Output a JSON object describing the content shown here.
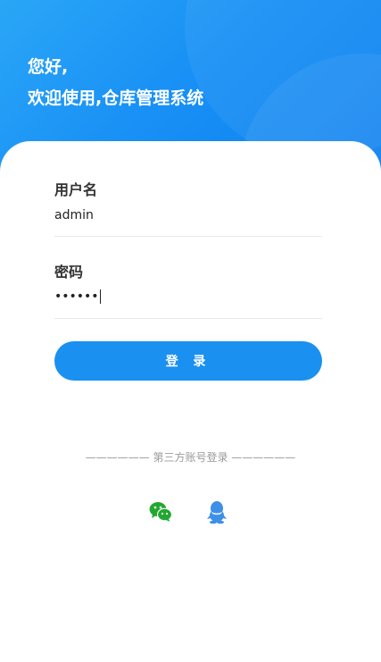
{
  "header": {
    "greeting_line1": "您好,",
    "greeting_line2": "欢迎使用,仓库管理系统"
  },
  "form": {
    "username_label": "用户名",
    "username_value": "admin",
    "password_label": "密码",
    "password_value": "••••••",
    "login_label": "登 录"
  },
  "third_party": {
    "divider_text": "—————— 第三方账号登录 ——————",
    "icons": [
      "wechat-icon",
      "qq-icon"
    ]
  },
  "colors": {
    "primary": "#1a90f0",
    "wechat": "#22a830",
    "qq": "#3d8fe8"
  }
}
